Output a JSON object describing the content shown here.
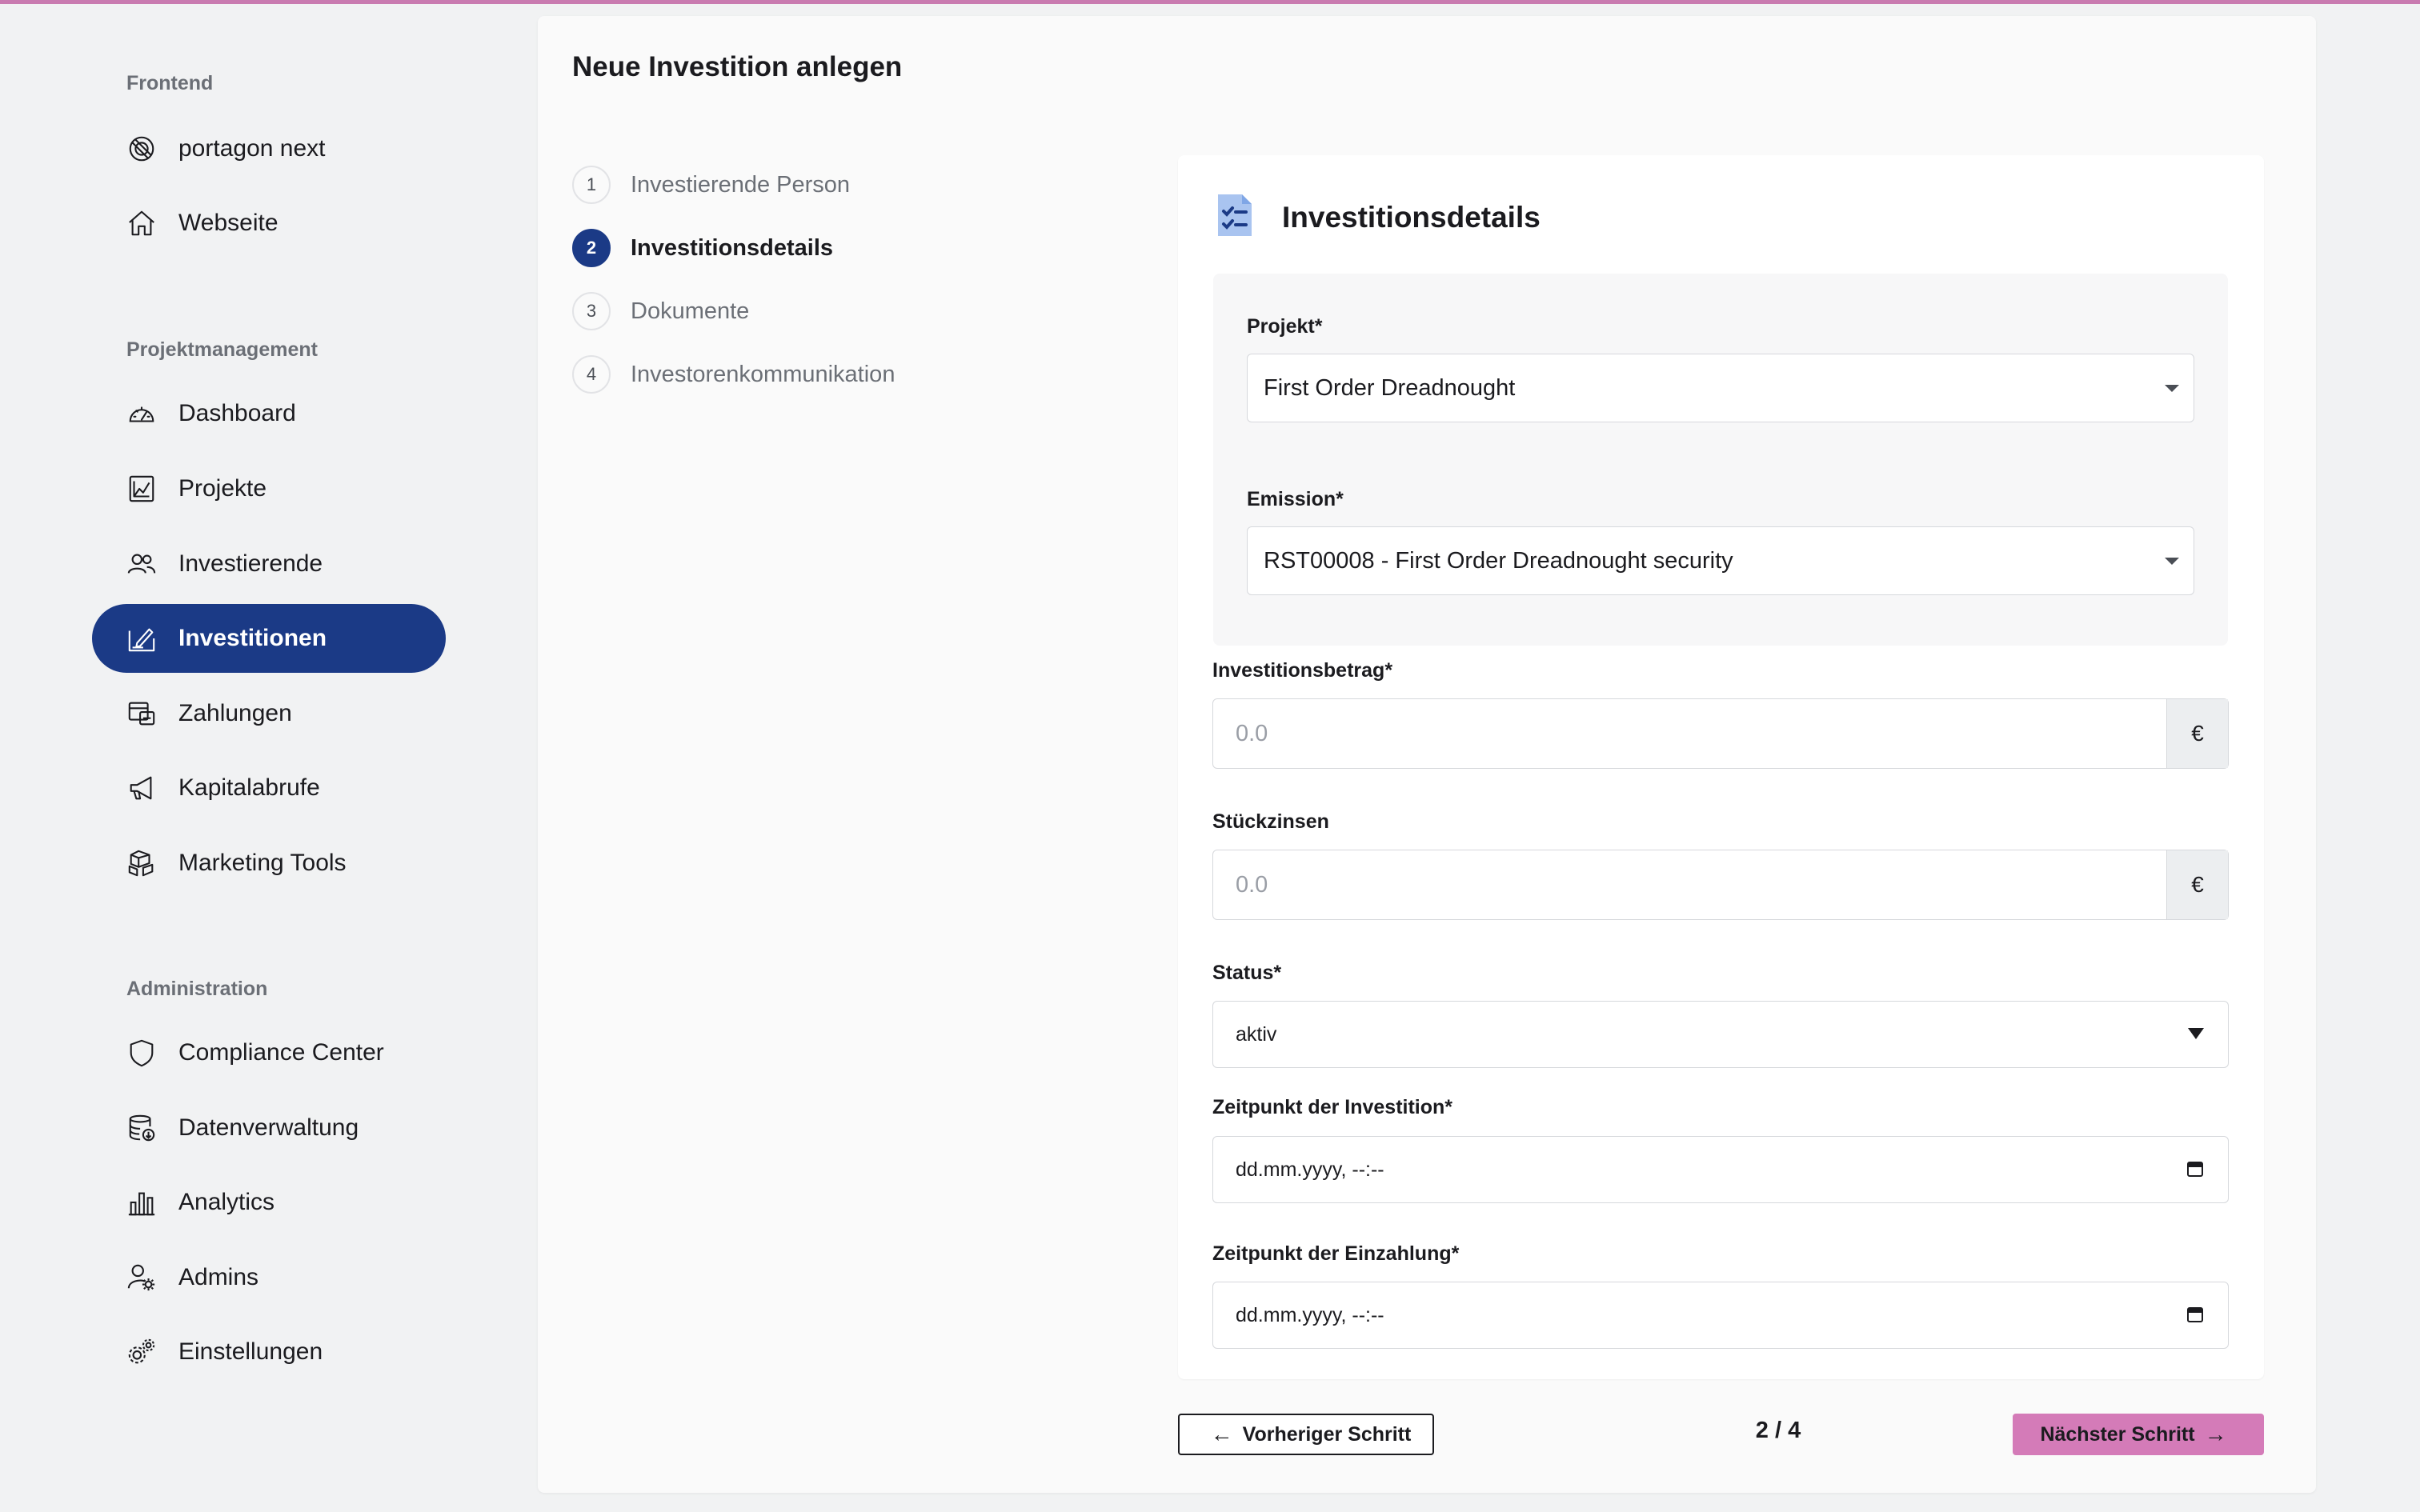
{
  "sidebar": {
    "sections": [
      {
        "title": "Frontend",
        "items": [
          {
            "label": "portagon next",
            "icon": "portagon-logo-icon"
          },
          {
            "label": "Webseite",
            "icon": "home-icon"
          }
        ]
      },
      {
        "title": "Projektmanagement",
        "items": [
          {
            "label": "Dashboard",
            "icon": "gauge-icon"
          },
          {
            "label": "Projekte",
            "icon": "chart-icon"
          },
          {
            "label": "Investierende",
            "icon": "users-icon"
          },
          {
            "label": "Investitionen",
            "icon": "signature-icon",
            "active": true
          },
          {
            "label": "Zahlungen",
            "icon": "payments-icon"
          },
          {
            "label": "Kapitalabrufe",
            "icon": "megaphone-icon"
          },
          {
            "label": "Marketing Tools",
            "icon": "boxes-icon"
          }
        ]
      },
      {
        "title": "Administration",
        "items": [
          {
            "label": "Compliance Center",
            "icon": "shield-icon"
          },
          {
            "label": "Datenverwaltung",
            "icon": "database-icon"
          },
          {
            "label": "Analytics",
            "icon": "bar-chart-icon"
          },
          {
            "label": "Admins",
            "icon": "user-gear-icon"
          },
          {
            "label": "Einstellungen",
            "icon": "gears-icon"
          }
        ]
      }
    ]
  },
  "page": {
    "title": "Neue Investition anlegen"
  },
  "steps": [
    {
      "num": "1",
      "label": "Investierende Person"
    },
    {
      "num": "2",
      "label": "Investitionsdetails",
      "active": true
    },
    {
      "num": "3",
      "label": "Dokumente"
    },
    {
      "num": "4",
      "label": "Investorenkommunikation"
    }
  ],
  "form": {
    "title": "Investitionsdetails",
    "icon": "document-checklist-icon",
    "projekt": {
      "label": "Projekt*",
      "value": "First Order Dreadnought"
    },
    "emission": {
      "label": "Emission*",
      "value": "RST00008 - First Order Dreadnought security"
    },
    "betrag": {
      "label": "Investitionsbetrag*",
      "placeholder": "0.0",
      "currency": "€"
    },
    "stueckzinsen": {
      "label": "Stückzinsen",
      "placeholder": "0.0",
      "currency": "€"
    },
    "status": {
      "label": "Status*",
      "value": "aktiv"
    },
    "zeitpunkt_investition": {
      "label": "Zeitpunkt der Investition*",
      "value": "dd.mm.yyyy, --:--"
    },
    "zeitpunkt_einzahlung": {
      "label": "Zeitpunkt der Einzahlung*",
      "value": "dd.mm.yyyy, --:--"
    }
  },
  "footer": {
    "prev_label": "Vorheriger Schritt",
    "next_label": "Nächster Schritt",
    "pager": "2 / 4"
  },
  "colors": {
    "accent": "#1b3a86",
    "next_button": "#d47bb8",
    "topbar": "#c97bb0"
  }
}
